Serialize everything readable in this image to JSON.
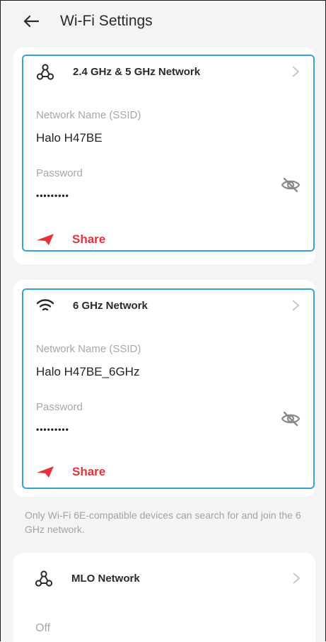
{
  "header": {
    "title": "Wi-Fi Settings",
    "back_icon": "arrow-left-icon"
  },
  "networks": [
    {
      "title": "2.4 GHz & 5 GHz Network",
      "icon": "network-nodes-icon",
      "ssid_label": "Network Name (SSID)",
      "ssid_value": "Halo H47BE",
      "password_label": "Password",
      "password_value": "•••••••••",
      "share_label": "Share"
    },
    {
      "title": "6 GHz Network",
      "icon": "wifi-icon",
      "ssid_label": "Network Name (SSID)",
      "ssid_value": "Halo H47BE_6GHz",
      "password_label": "Password",
      "password_value": "•••••••••",
      "share_label": "Share"
    }
  ],
  "note": "Only Wi-Fi 6E-compatible devices can search for and join the 6 GHz network.",
  "mlo": {
    "title": "MLO Network",
    "icon": "network-nodes-icon",
    "status": "Off"
  },
  "colors": {
    "accent_border": "#37a3d6",
    "share_red": "#e5323b",
    "label_gray": "#a8a8a8",
    "background": "#f3f4f6"
  }
}
